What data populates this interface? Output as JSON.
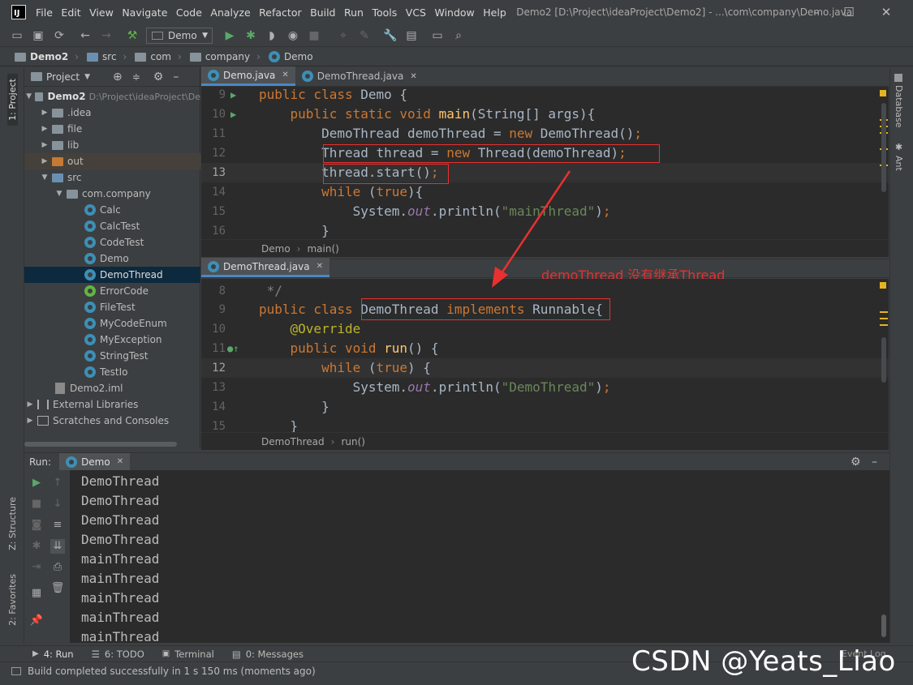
{
  "app": {
    "icon_text": "IJ",
    "window_title": "Demo2 [D:\\Project\\ideaProject\\Demo2] - ...\\com\\company\\Demo.java"
  },
  "menu": [
    "File",
    "Edit",
    "View",
    "Navigate",
    "Code",
    "Analyze",
    "Refactor",
    "Build",
    "Run",
    "Tools",
    "VCS",
    "Window",
    "Help"
  ],
  "toolbar": {
    "run_config": "Demo"
  },
  "breadcrumb": [
    "Demo2",
    "src",
    "com",
    "company",
    "Demo"
  ],
  "project": {
    "header": "Project",
    "root_label": "Demo2",
    "root_path": "D:\\Project\\ideaProject\\De",
    "items": [
      ".idea",
      "file",
      "lib",
      "out",
      "src",
      "com.company"
    ],
    "classes": [
      "Calc",
      "CalcTest",
      "CodeTest",
      "Demo",
      "DemoThread",
      "ErrorCode",
      "FileTest",
      "MyCodeEnum",
      "MyException",
      "StringTest",
      "TestIo"
    ],
    "iml": "Demo2.iml",
    "external": "External Libraries",
    "scratches": "Scratches and Consoles"
  },
  "left_strip": {
    "project_tab": "1: Project",
    "structure_tab": "Z: Structure",
    "favorites_tab": "2: Favorites"
  },
  "right_strip": {
    "database": "Database",
    "ant": "Ant"
  },
  "editor_top": {
    "tabs": [
      "Demo.java",
      "DemoThread.java"
    ],
    "line_numbers": [
      "9",
      "10",
      "11",
      "12",
      "13",
      "14",
      "15",
      "16"
    ],
    "breadcrumb": [
      "Demo",
      "main()"
    ]
  },
  "editor_bottom": {
    "tab": "DemoThread.java",
    "line_numbers": [
      "8",
      "9",
      "10",
      "11",
      "12",
      "13",
      "14",
      "15"
    ],
    "breadcrumb": [
      "DemoThread",
      "run()"
    ]
  },
  "annotation": "demoThread 没有继承Thread",
  "run": {
    "label": "Run:",
    "tab": "Demo",
    "output": [
      "DemoThread",
      "DemoThread",
      "DemoThread",
      "DemoThread",
      "mainThread",
      "mainThread",
      "mainThread",
      "mainThread",
      "mainThread"
    ]
  },
  "bottom_tabs": [
    "4: Run",
    "6: TODO",
    "Terminal",
    "0: Messages"
  ],
  "event_log": "Event Log",
  "status": "Build completed successfully in 1 s 150 ms (moments ago)",
  "watermark": "CSDN @Yeats_Liao",
  "colors": {
    "keyword": "#cc7832",
    "function": "#ffc66d",
    "string": "#6a8759",
    "static": "#9876aa",
    "annotation": "#bbb529",
    "highlight_box": "#e8312f"
  }
}
